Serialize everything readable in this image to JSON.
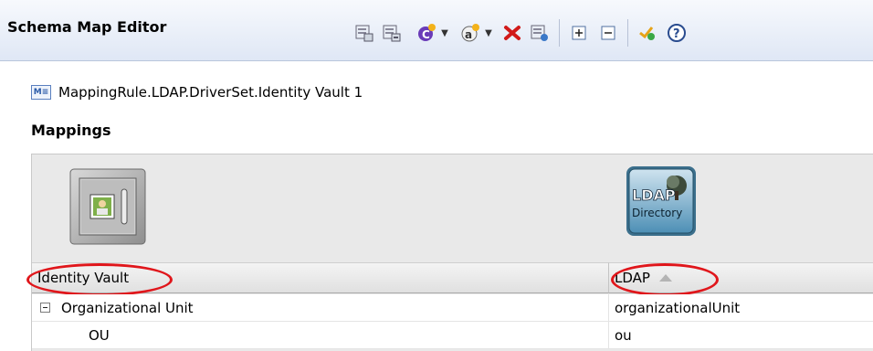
{
  "header": {
    "title": "Schema Map Editor",
    "toolbar": [
      {
        "name": "add-class-icon",
        "interactable": true
      },
      {
        "name": "add-attribute-icon",
        "interactable": true
      },
      {
        "name": "class-add-icon",
        "interactable": true,
        "dropdown": true
      },
      {
        "name": "attribute-add-icon",
        "interactable": true,
        "dropdown": true
      },
      {
        "name": "delete-icon",
        "interactable": true
      },
      {
        "name": "refresh-schema-icon",
        "interactable": true
      },
      {
        "name": "expand-all-icon",
        "interactable": true
      },
      {
        "name": "collapse-all-icon",
        "interactable": true
      },
      {
        "name": "check-icon",
        "interactable": true
      },
      {
        "name": "help-icon",
        "interactable": true
      }
    ]
  },
  "rule": {
    "icon_text": "M≡",
    "name": "MappingRule.LDAP.DriverSet.Identity Vault 1"
  },
  "mappings": {
    "title": "Mappings",
    "ldap_logo_line1": "LDAP",
    "ldap_logo_line2": "Directory",
    "columns": {
      "left": "Identity Vault",
      "right": "LDAP"
    },
    "rows": [
      {
        "left": "Organizational Unit",
        "right": "organizationalUnit",
        "expandable": true
      },
      {
        "left": "OU",
        "right": "ou",
        "expandable": false
      }
    ]
  },
  "colors": {
    "annotation": "#e0161b",
    "delete": "#d11a1a"
  }
}
